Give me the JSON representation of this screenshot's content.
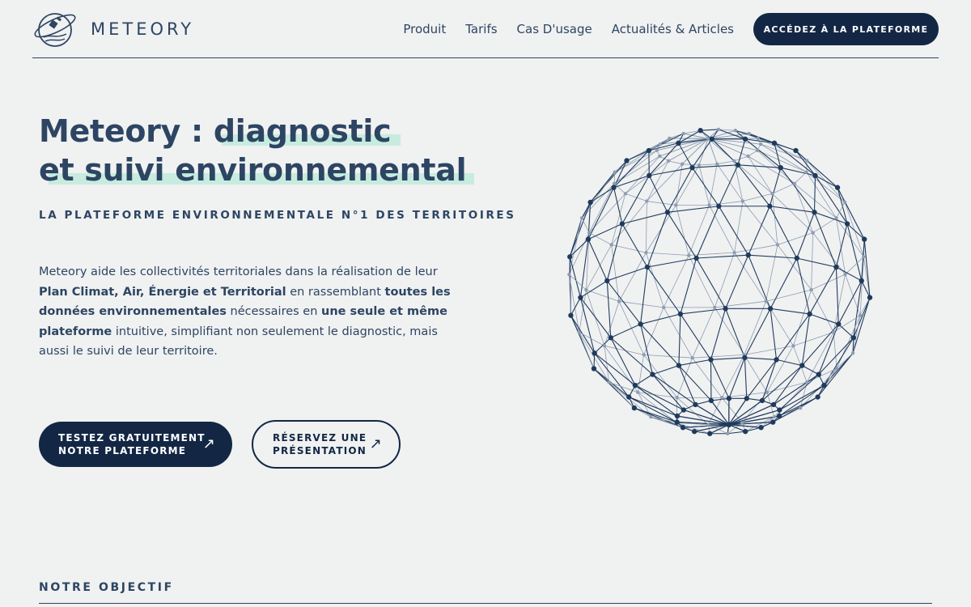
{
  "brand": {
    "name": "METEORY",
    "logo_icon": "satellite-globe-icon"
  },
  "nav": {
    "items": [
      "Produit",
      "Tarifs",
      "Cas D'usage",
      "Actualités & Articles"
    ],
    "cta": "ACCÉDEZ À LA PLATEFORME"
  },
  "hero": {
    "title_part1": "Meteory : ",
    "title_highlight1": "diagnostic",
    "title_highlight2": "et suivi environnemental",
    "tagline": "LA PLATEFORME ENVIRONNEMENTALE N°1 DES TERRITOIRES",
    "desc": [
      "Meteory aide les collectivités territoriales dans la réalisation de leur ",
      "Plan Climat, Air, Énergie et Territorial",
      " en rassemblant ",
      "toutes les données environnementales",
      " nécessaires en ",
      "une seule et même plateforme",
      " intuitive, simplifiant non seulement le diagnostic, mais aussi le suivi de leur territoire."
    ],
    "btn_primary_line1": "TESTEZ GRATUITEMENT",
    "btn_primary_line2": "NOTRE PLATEFORME",
    "btn_secondary_line1": "RÉSERVEZ UNE",
    "btn_secondary_line2": "PRÉSENTATION",
    "arrow_icon": "↗",
    "globe_icon": "wireframe-globe-icon"
  },
  "section": {
    "objective": "NOTRE OBJECTIF"
  },
  "colors": {
    "primary": "#132745",
    "text": "#2d4563",
    "highlight": "#c7ecdf",
    "background": "#f0f1f1"
  }
}
